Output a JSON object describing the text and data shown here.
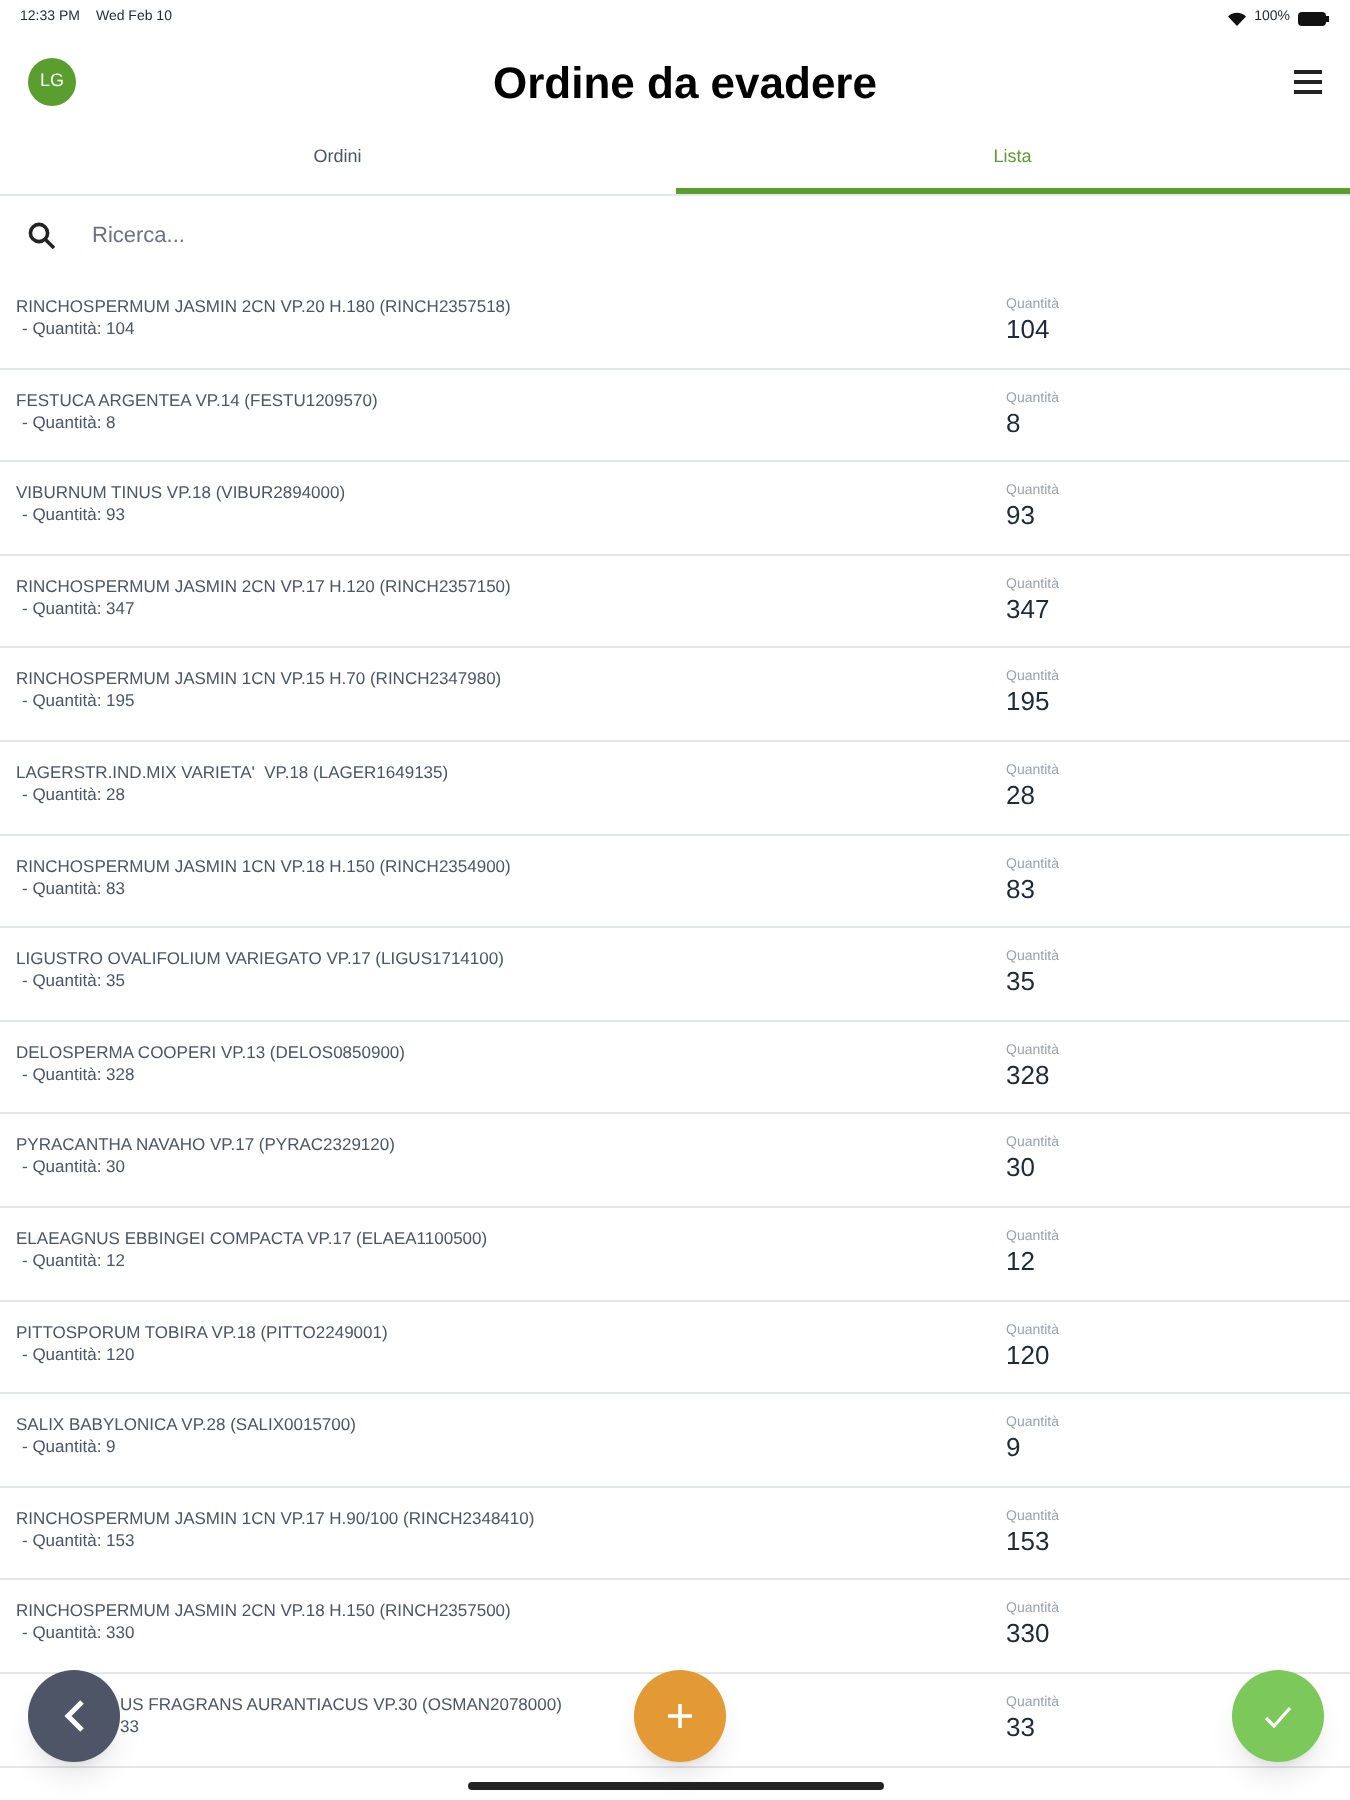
{
  "status_bar": {
    "time": "12:33 PM",
    "date": "Wed Feb 10",
    "battery": "100%"
  },
  "header": {
    "avatar": "LG",
    "title": "Ordine da evadere"
  },
  "tabs": [
    {
      "label": "Ordini",
      "selected": false
    },
    {
      "label": "Lista",
      "selected": true
    }
  ],
  "search": {
    "placeholder": "Ricerca..."
  },
  "items": [
    {
      "name": "RINCHOSPERMUM JASMIN 2CN VP.20 H.180 (RINCH2357518)",
      "detail": "- Quantità: 104",
      "qty_label": "Quantità",
      "qty": "104"
    },
    {
      "name": "FESTUCA ARGENTEA VP.14 (FESTU1209570)",
      "detail": "- Quantità: 8",
      "qty_label": "Quantità",
      "qty": "8"
    },
    {
      "name": "VIBURNUM TINUS VP.18 (VIBUR2894000)",
      "detail": "- Quantità: 93",
      "qty_label": "Quantità",
      "qty": "93"
    },
    {
      "name": "RINCHOSPERMUM JASMIN 2CN VP.17 H.120 (RINCH2357150)",
      "detail": "- Quantità: 347",
      "qty_label": "Quantità",
      "qty": "347"
    },
    {
      "name": "RINCHOSPERMUM JASMIN 1CN VP.15 H.70 (RINCH2347980)",
      "detail": "- Quantità: 195",
      "qty_label": "Quantità",
      "qty": "195"
    },
    {
      "name": "LAGERSTR.IND.MIX VARIETA'  VP.18 (LAGER1649135)",
      "detail": "- Quantità: 28",
      "qty_label": "Quantità",
      "qty": "28"
    },
    {
      "name": "RINCHOSPERMUM JASMIN 1CN VP.18 H.150 (RINCH2354900)",
      "detail": "- Quantità: 83",
      "qty_label": "Quantità",
      "qty": "83"
    },
    {
      "name": "LIGUSTRO OVALIFOLIUM VARIEGATO VP.17 (LIGUS1714100)",
      "detail": "- Quantità: 35",
      "qty_label": "Quantità",
      "qty": "35"
    },
    {
      "name": "DELOSPERMA COOPERI VP.13 (DELOS0850900)",
      "detail": "- Quantità: 328",
      "qty_label": "Quantità",
      "qty": "328"
    },
    {
      "name": "PYRACANTHA NAVAHO VP.17 (PYRAC2329120)",
      "detail": "- Quantità: 30",
      "qty_label": "Quantità",
      "qty": "30"
    },
    {
      "name": "ELAEAGNUS EBBINGEI COMPACTA VP.17 (ELAEA1100500)",
      "detail": "- Quantità: 12",
      "qty_label": "Quantità",
      "qty": "12"
    },
    {
      "name": "PITTOSPORUM TOBIRA VP.18 (PITTO2249001)",
      "detail": "- Quantità: 120",
      "qty_label": "Quantità",
      "qty": "120"
    },
    {
      "name": "SALIX BABYLONICA VP.28 (SALIX0015700)",
      "detail": "- Quantità: 9",
      "qty_label": "Quantità",
      "qty": "9"
    },
    {
      "name": "RINCHOSPERMUM JASMIN 1CN VP.17 H.90/100 (RINCH2348410)",
      "detail": "- Quantità: 153",
      "qty_label": "Quantità",
      "qty": "153"
    },
    {
      "name": "RINCHOSPERMUM JASMIN 2CN VP.18 H.150 (RINCH2357500)",
      "detail": "- Quantità: 330",
      "qty_label": "Quantità",
      "qty": "330"
    },
    {
      "name": "US FRAGRANS AURANTIACUS VP.30 (OSMAN2078000)",
      "detail": "33",
      "qty_label": "Quantità",
      "qty": "33"
    }
  ]
}
